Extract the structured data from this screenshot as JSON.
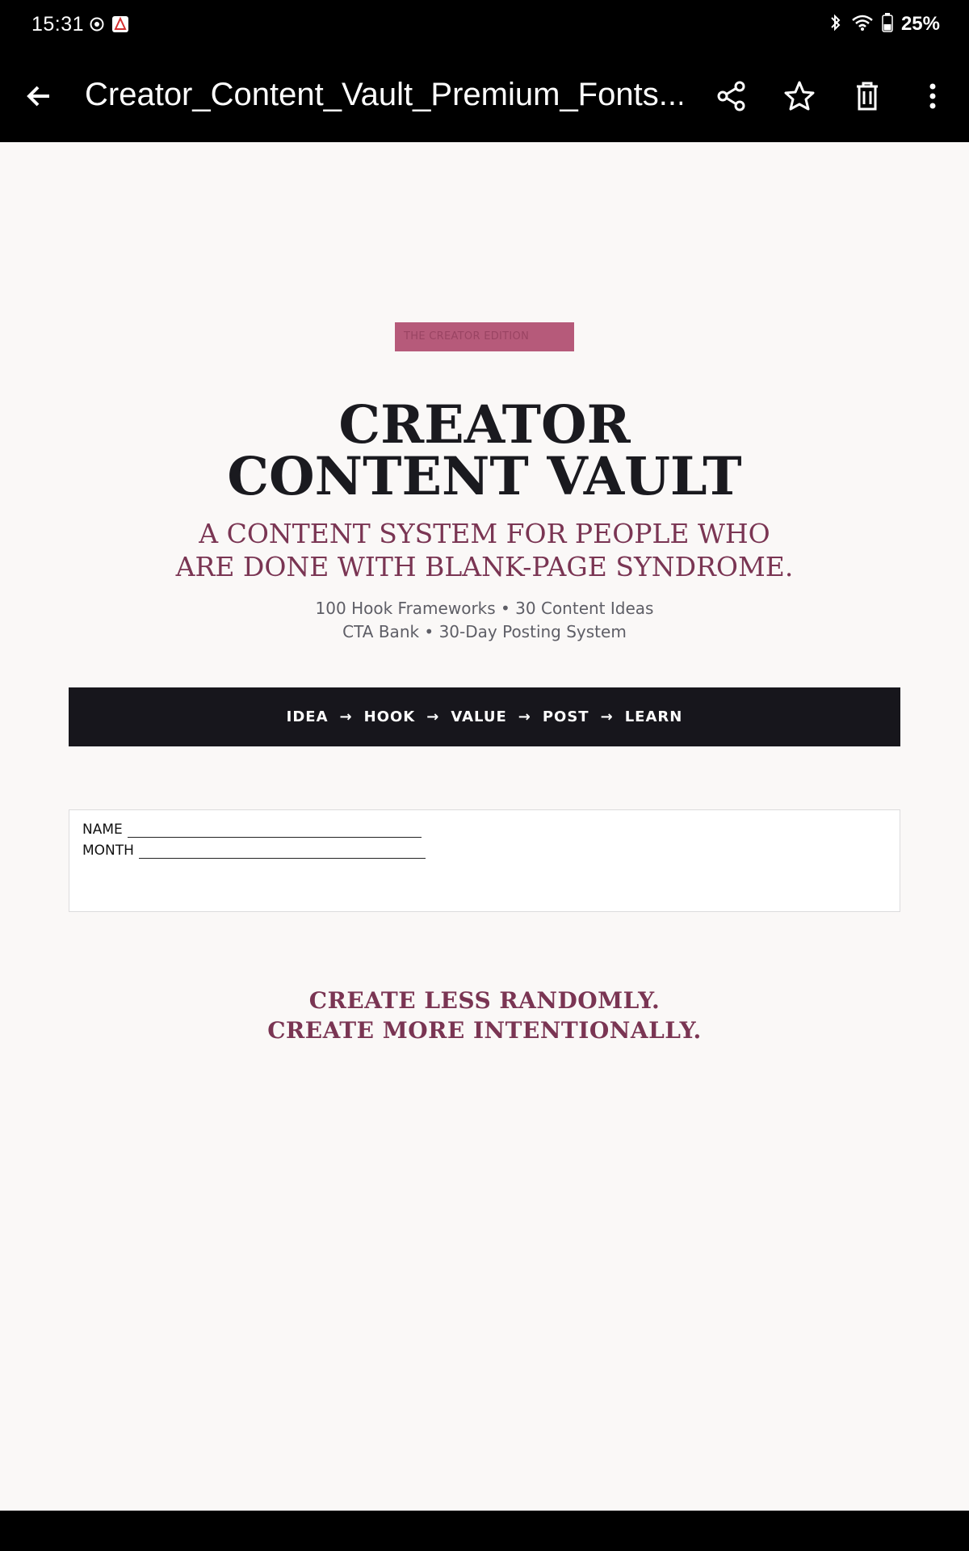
{
  "status_bar": {
    "time": "15:31",
    "battery_percent": "25%",
    "icons": [
      "chrome-icon",
      "pdf-app-icon",
      "bluetooth-icon",
      "wifi-icon",
      "battery-icon"
    ]
  },
  "app_bar": {
    "title": "Creator_Content_Vault_Premium_Fonts....",
    "actions": [
      "back-arrow-icon",
      "share-icon",
      "star-icon",
      "delete-icon",
      "more-vertical-icon"
    ]
  },
  "document": {
    "badge": "THE CREATOR EDITION",
    "title_line1": "CREATOR",
    "title_line2": "CONTENT VAULT",
    "subtitle_line1": "A CONTENT SYSTEM FOR PEOPLE WHO",
    "subtitle_line2": "ARE DONE WITH BLANK-PAGE SYNDROME.",
    "features_line1": "100 Hook Frameworks • 30 Content Ideas",
    "features_line2": "CTA Bank • 30-Day Posting System",
    "process_steps": [
      "IDEA",
      "HOOK",
      "VALUE",
      "POST",
      "LEARN"
    ],
    "process_arrow": "→",
    "name_label": "NAME",
    "month_label": "MONTH",
    "tagline_line1": "CREATE LESS RANDOMLY.",
    "tagline_line2": "CREATE MORE INTENTIONALLY."
  },
  "colors": {
    "accent": "#7a3553",
    "badge": "#b65a7a",
    "dark": "#17161c",
    "background": "#faf8f7"
  }
}
